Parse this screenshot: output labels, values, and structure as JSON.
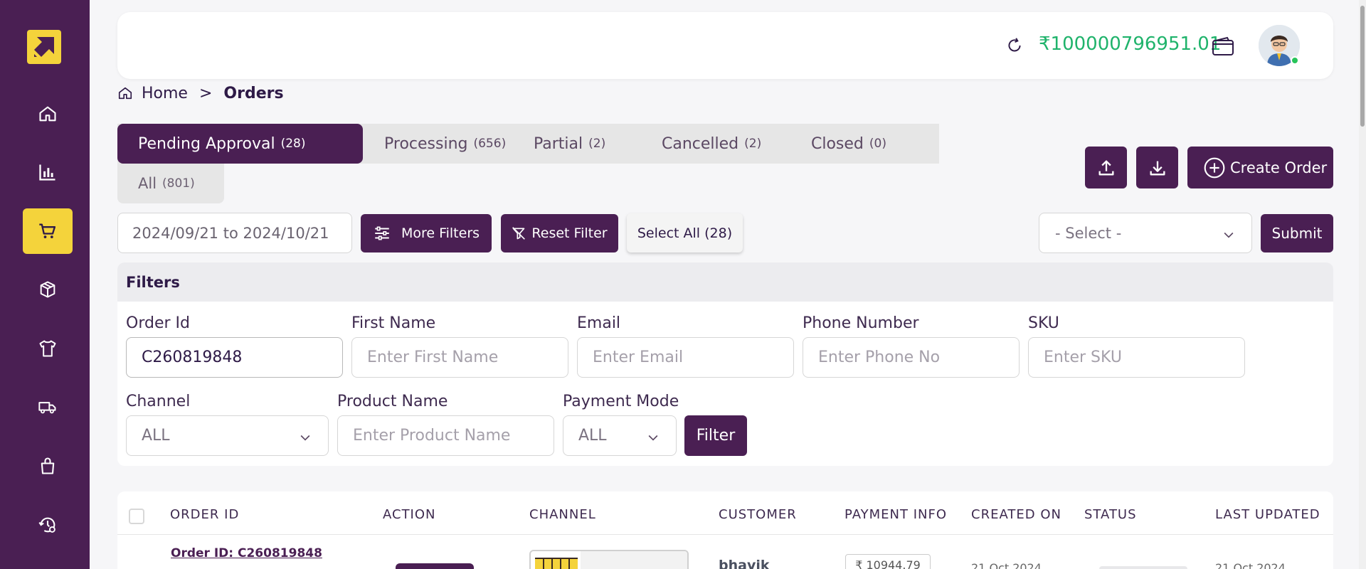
{
  "colors": {
    "brand": "#4a1f53",
    "accent": "#f4d33b",
    "balance": "#1fb36b",
    "online": "#27c45a"
  },
  "sidebar": {
    "logo_icon": "arrow-logo",
    "items": [
      {
        "icon": "home-icon",
        "active": false
      },
      {
        "icon": "chart-icon",
        "active": false
      },
      {
        "icon": "cart-icon",
        "active": true
      },
      {
        "icon": "box-icon",
        "active": false
      },
      {
        "icon": "tshirt-icon",
        "active": false
      },
      {
        "icon": "truck-icon",
        "active": false
      },
      {
        "icon": "bag-icon",
        "active": false
      },
      {
        "icon": "settings-history-icon",
        "active": false
      }
    ]
  },
  "header": {
    "balance": "₹100000796951.01"
  },
  "breadcrumb": {
    "home": "Home",
    "separator": ">",
    "current": "Orders"
  },
  "tabs": [
    {
      "label": "Pending Approval",
      "count": "(28)"
    },
    {
      "label": "Processing",
      "count": "(656)"
    },
    {
      "label": "Partial",
      "count": "(2)"
    },
    {
      "label": "Cancelled",
      "count": "(2)"
    },
    {
      "label": "Closed",
      "count": "(0)"
    },
    {
      "label": "All",
      "count": "(801)"
    }
  ],
  "actions": {
    "create_order": "Create Order"
  },
  "toolbar": {
    "date_range": "2024/09/21 to 2024/10/21",
    "more_filters": "More Filters",
    "reset_filter": "Reset Filter",
    "select_all": "Select All (28)",
    "bulk_select": "- Select -",
    "submit": "Submit"
  },
  "filters": {
    "title": "Filters",
    "order_id": {
      "label": "Order Id",
      "value": "C260819848"
    },
    "first_name": {
      "label": "First Name",
      "placeholder": "Enter First Name"
    },
    "email": {
      "label": "Email",
      "placeholder": "Enter Email"
    },
    "phone": {
      "label": "Phone Number",
      "placeholder": "Enter Phone No"
    },
    "sku": {
      "label": "SKU",
      "placeholder": "Enter SKU"
    },
    "channel": {
      "label": "Channel",
      "value": "ALL"
    },
    "product_name": {
      "label": "Product Name",
      "placeholder": "Enter Product Name"
    },
    "payment_mode": {
      "label": "Payment Mode",
      "value": "ALL"
    },
    "filter_button": "Filter"
  },
  "table": {
    "columns": [
      "ORDER ID",
      "ACTION",
      "CHANNEL",
      "CUSTOMER",
      "PAYMENT INFO",
      "CREATED ON",
      "STATUS",
      "LAST UPDATED"
    ],
    "rows": [
      {
        "order_id": "Order ID: C260819848",
        "customer": "bhavik",
        "payment": "₹ 10944.79",
        "created": "21 Oct 2024",
        "updated": "21 Oct 2024"
      }
    ]
  }
}
